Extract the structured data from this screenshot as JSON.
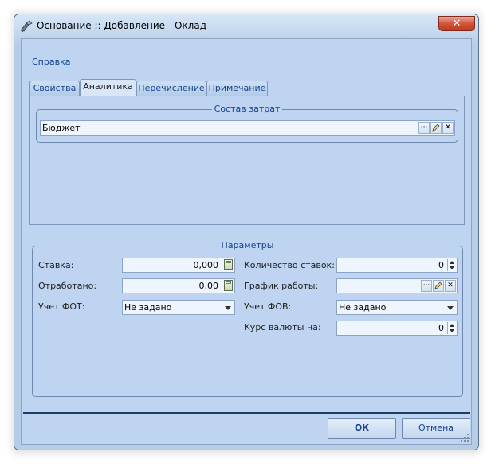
{
  "window": {
    "title": "Основание :: Добавление - Оклад",
    "close_label": "✕"
  },
  "menu": {
    "spravka": "Справка"
  },
  "tabs": [
    {
      "label": "Свойства"
    },
    {
      "label": "Аналитика"
    },
    {
      "label": "Перечисление"
    },
    {
      "label": "Примечание"
    }
  ],
  "sostav": {
    "caption": "Состав затрат",
    "value": "Бюджет",
    "dots_label": "···",
    "clear_label": "✕"
  },
  "params": {
    "caption": "Параметры",
    "stavka": {
      "label": "Ставка:",
      "value": "0,000"
    },
    "otrabotano": {
      "label": "Отработано:",
      "value": "0,00"
    },
    "uchet_fot": {
      "label": "Учет ФОТ:",
      "value": "Не задано"
    },
    "kolichestvo": {
      "label": "Количество ставок:",
      "value": "0"
    },
    "grafik": {
      "label": "График работы:",
      "value": "",
      "dots_label": "···",
      "clear_label": "✕"
    },
    "uchet_fov": {
      "label": "Учет ФОВ:",
      "value": "Не задано"
    },
    "kurs": {
      "label": "Курс валюты на:",
      "value": "0"
    }
  },
  "buttons": {
    "ok": "ОК",
    "cancel": "Отмена"
  }
}
